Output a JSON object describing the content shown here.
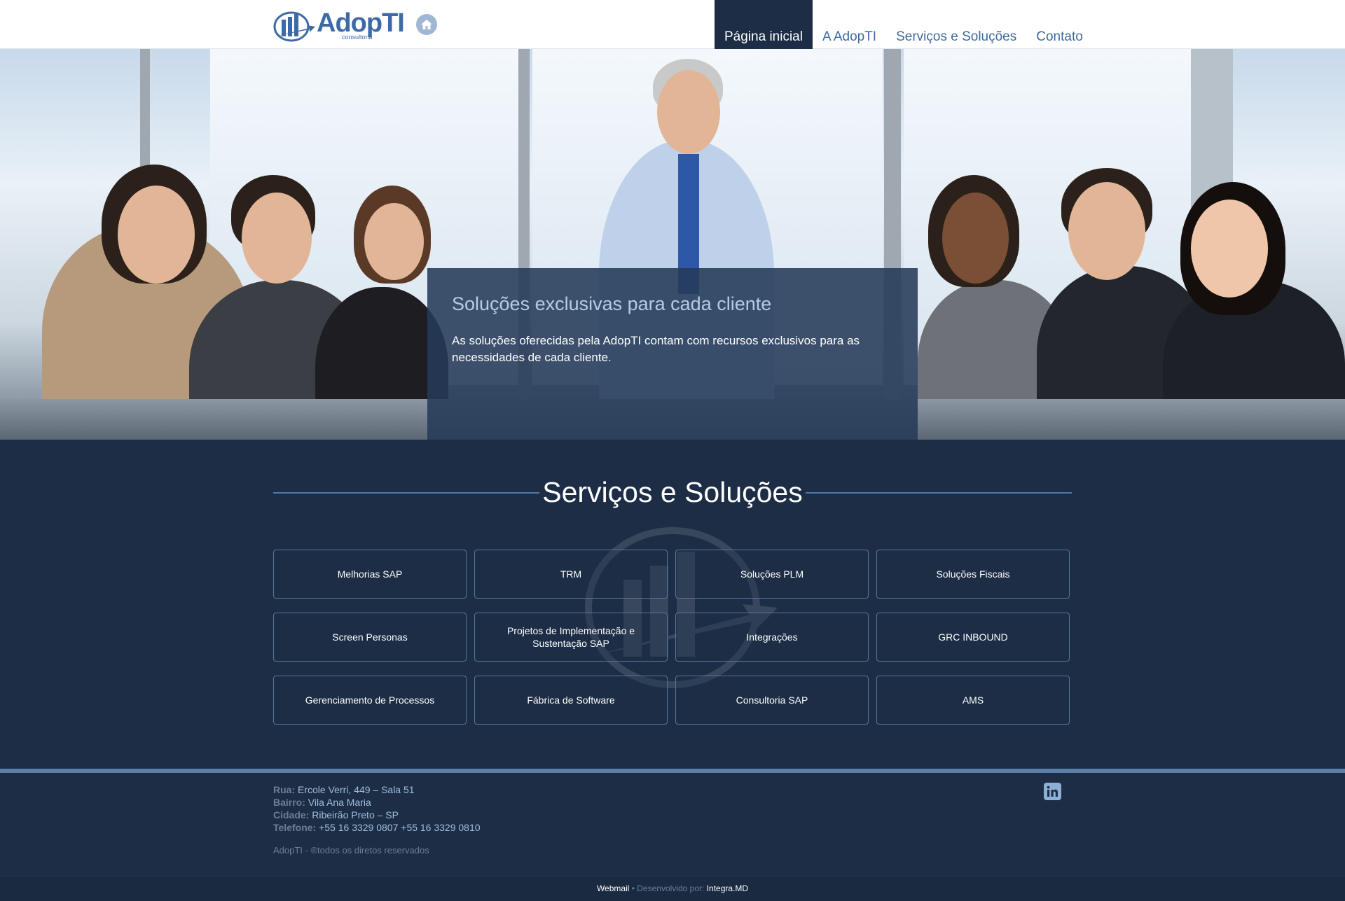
{
  "header": {
    "logo_text": "AdopTI",
    "logo_sub": "consultoria",
    "nav": [
      {
        "label": "Página inicial"
      },
      {
        "label": "A AdopTI"
      },
      {
        "label": "Serviços e Soluções"
      },
      {
        "label": "Contato"
      }
    ]
  },
  "hero": {
    "title": "Soluções exclusivas para cada cliente",
    "text": "As soluções oferecidas pela AdopTI contam com recursos exclusivos para as necessidades de cada cliente."
  },
  "services": {
    "title": "Serviços e Soluções",
    "items": [
      "Melhorias SAP",
      "TRM",
      "Soluções PLM",
      "Soluções Fiscais",
      "Screen Personas",
      "Projetos de Implementação e Sustentação SAP",
      "Integrações",
      "GRC INBOUND",
      "Gerenciamento de Processos",
      "Fábrica de Software",
      "Consultoria SAP",
      "AMS"
    ]
  },
  "footer": {
    "rua_label": "Rua:",
    "rua": "Ercole Verri, 449 – Sala 51",
    "bairro_label": "Bairro:",
    "bairro": "Vila Ana Maria",
    "cidade_label": "Cidade:",
    "cidade": "Ribeirão Preto – SP",
    "telefone_label": "Telefone:",
    "telefone": "+55 16 3329 0807 +55 16 3329 0810",
    "copyright": "AdopTI - ®todos os diretos reservados",
    "webmail": "Webmail",
    "separator": "•",
    "developed_by": "Desenvolvido por:",
    "developer": "Integra.MD"
  },
  "colors": {
    "primary_navy": "#1c2d45",
    "nav_blue": "#3f6a9f",
    "accent_line": "#4d78a6"
  },
  "icons": [
    "logo-mark-icon",
    "home-icon",
    "linkedin-icon"
  ]
}
